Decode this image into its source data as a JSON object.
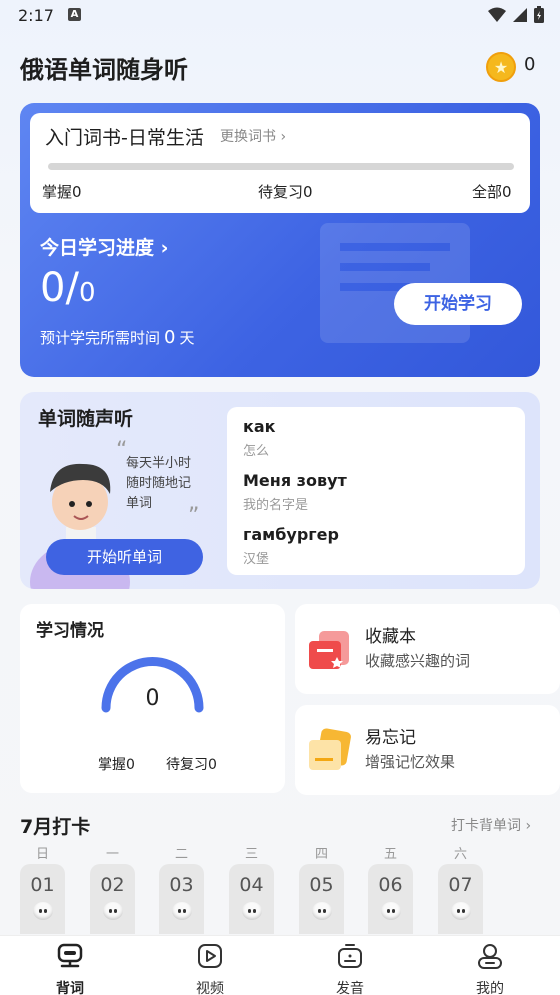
{
  "status": {
    "time": "2:17",
    "a_badge": "A"
  },
  "header": {
    "title": "俄语单词随身听",
    "coins": "0"
  },
  "book": {
    "name": "入门词书-日常生活",
    "change": "更换词书",
    "progress": 0,
    "mastered_label": "掌握",
    "mastered": "0",
    "review_label": "待复习",
    "review": "0",
    "all_label": "全部",
    "all": "0"
  },
  "today": {
    "label": "今日学习进度",
    "done": "0",
    "slash": "/",
    "total": "0",
    "estimate_prefix": "预计学完所需时间",
    "estimate_value": "0",
    "estimate_unit": "天",
    "start_label": "开始学习"
  },
  "listen": {
    "title": "单词随声听",
    "quote": [
      "每天半小时",
      "随时随地记",
      "单词"
    ],
    "button": "开始听单词",
    "words": [
      {
        "ru": "как",
        "cn": "怎么"
      },
      {
        "ru": "Меня зовут",
        "cn": "我的名字是"
      },
      {
        "ru": "гамбургер",
        "cn": "汉堡"
      }
    ]
  },
  "situation": {
    "title": "学习情况",
    "value": "0",
    "mastered_label": "掌握",
    "mastered": "0",
    "review_label": "待复习",
    "review": "0"
  },
  "favorites": {
    "title": "收藏本",
    "subtitle": "收藏感兴趣的词"
  },
  "forgettable": {
    "title": "易忘记",
    "subtitle": "增强记忆效果"
  },
  "checkin": {
    "title": "7月打卡",
    "link": "打卡背单词",
    "weekdays": [
      "日",
      "一",
      "二",
      "三",
      "四",
      "五",
      "六"
    ],
    "days": [
      "01",
      "02",
      "03",
      "04",
      "05",
      "06",
      "07"
    ]
  },
  "nav": {
    "words": "背词",
    "video": "视频",
    "pronunciation": "发音",
    "mine": "我的"
  },
  "colors": {
    "primary": "#3d63e3",
    "accent_teal": "#6ee3d0",
    "coin": "#f5b81d"
  }
}
